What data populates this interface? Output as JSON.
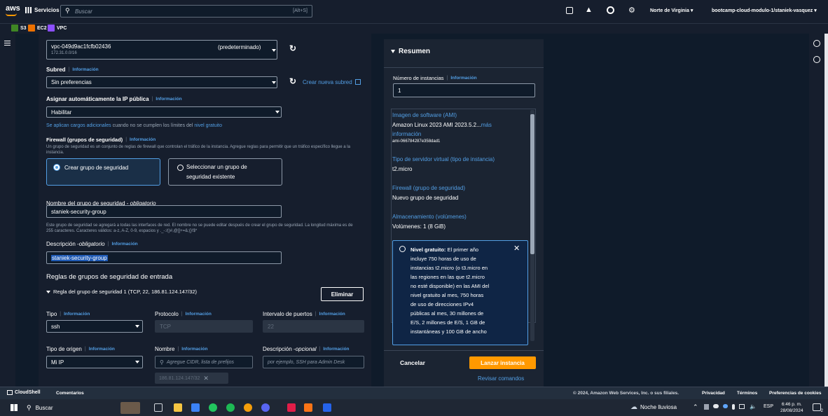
{
  "topbar": {
    "logo": "aws",
    "services": "Servicios",
    "search_placeholder": "Buscar",
    "shortcut": "[Alt+S]",
    "region": "Norte de Virginia",
    "account": "bootcamp-cloud-modulo-1/staniek-vasquez"
  },
  "favorites": [
    {
      "label": "S3",
      "color": "#3f8624"
    },
    {
      "label": "EC2",
      "color": "#ed7100"
    },
    {
      "label": "VPC",
      "color": "#8c4fff"
    }
  ],
  "network": {
    "vpc_value": "vpc-049d9ac1fcfb02436",
    "vpc_tag": "(predeterminado)",
    "vpc_cidr": "172.31.0.0/16",
    "subnet_label": "Subred",
    "subnet_info": "Información",
    "subnet_value": "Sin preferencias",
    "create_subnet": "Crear nueva subred",
    "autoip_label": "Asignar automáticamente la IP pública",
    "autoip_info": "Información",
    "autoip_value": "Habilitar",
    "charges_link": "Se aplican cargos adicionales",
    "charges_mid": " cuando no se cumplen los límites del ",
    "charges_tier": "nivel gratuito",
    "firewall_label": "Firewall (grupos de seguridad)",
    "firewall_info": "Información",
    "firewall_help": "Un grupo de seguridad es un conjunto de reglas de firewall que controlan el tráfico de la instancia. Agregue reglas para permitir que un tráfico específico llegue a la instancia.",
    "radio_create": "Crear grupo de seguridad",
    "radio_select_1": "Seleccionar un grupo de",
    "radio_select_2": "seguridad existente",
    "sgname_label": "Nombre del grupo de seguridad - ",
    "sgname_req": "obligatorio",
    "sgname_value": "staniek-security-group",
    "sgname_help": "Este grupo de seguridad se agregará a todas las interfaces de red. El nombre no se puede editar después de crear el grupo de seguridad. La longitud máxima es de 255 caracteres. Caracteres válidos: a-z, A-Z, 0-9, espacios y ._-:/()#,@[]+=&;{}!$*",
    "desc_label": "Descripción - ",
    "desc_req": "obligatorio",
    "desc_info": "Información",
    "desc_value": "staniek-security-group",
    "rules_title": "Reglas de grupos de seguridad de entrada",
    "rule1_title": "Regla del grupo de seguridad 1 (TCP, 22, 186.81.124.147/32)",
    "delete_btn": "Eliminar",
    "type_label": "Tipo",
    "type_info": "Información",
    "type_value": "ssh",
    "proto_label": "Protocolo",
    "proto_info": "Información",
    "proto_value": "TCP",
    "ports_label": "Intervalo de puertos",
    "ports_info": "Información",
    "ports_value": "22",
    "origin_label": "Tipo de origen",
    "origin_info": "Información",
    "origin_value": "Mi IP",
    "name_label": "Nombre",
    "name_info": "Información",
    "name_placeholder": "Agregue CIDR, lista de prefijos",
    "rdesc_label": "Descripción - ",
    "rdesc_opt": "opcional",
    "rdesc_info": "Información",
    "rdesc_placeholder": "por ejemplo, SSH para Admin Desk",
    "cidr_token": "186.81.124.147/32"
  },
  "summary": {
    "title": "Resumen",
    "count_label": "Número de instancias",
    "count_info": "Información",
    "count_value": "1",
    "ami_label": "Imagen de software (AMI)",
    "ami_value": "Amazon Linux 2023 AMI 2023.5.2...",
    "ami_more": "más",
    "ami_more2": "información",
    "ami_id": "ami-066784287e358dad1",
    "type_label": "Tipo de servidor virtual (tipo de instancia)",
    "type_value": "t2.micro",
    "fw_label": "Firewall (grupo de seguridad)",
    "fw_value": "Nuevo grupo de seguridad",
    "storage_label": "Almacenamiento (volúmenes)",
    "storage_value": "Volúmenes: 1 (8 GiB)",
    "tier_bold": "Nivel gratuito:",
    "tier_lines": [
      " El primer año",
      "incluye 750 horas de uso de",
      "instancias t2.micro (o t3.micro en",
      "las regiones en las que t2.micro",
      "no esté disponible) en las AMI del",
      "nivel gratuito al mes, 750 horas",
      "de uso de direcciones IPv4",
      "públicas al mes, 30 millones de",
      "E/S, 2 millones de E/S, 1 GB de",
      "instantáneas y 100 GB de ancho"
    ],
    "cancel": "Cancelar",
    "launch": "Lanzar instancia",
    "review": "Revisar comandos"
  },
  "footer": {
    "cloudshell": "CloudShell",
    "comments": "Comentarios",
    "copyright": "© 2024, Amazon Web Services, Inc. o sus filiales.",
    "privacy": "Privacidad",
    "terms": "Términos",
    "cookies": "Preferencias de cookies"
  },
  "taskbar": {
    "search": "Buscar",
    "weather": "Noche lluviosa",
    "lang": "ESP",
    "time": "6:46 p. m.",
    "date": "28/08/2024",
    "notif": "2"
  }
}
